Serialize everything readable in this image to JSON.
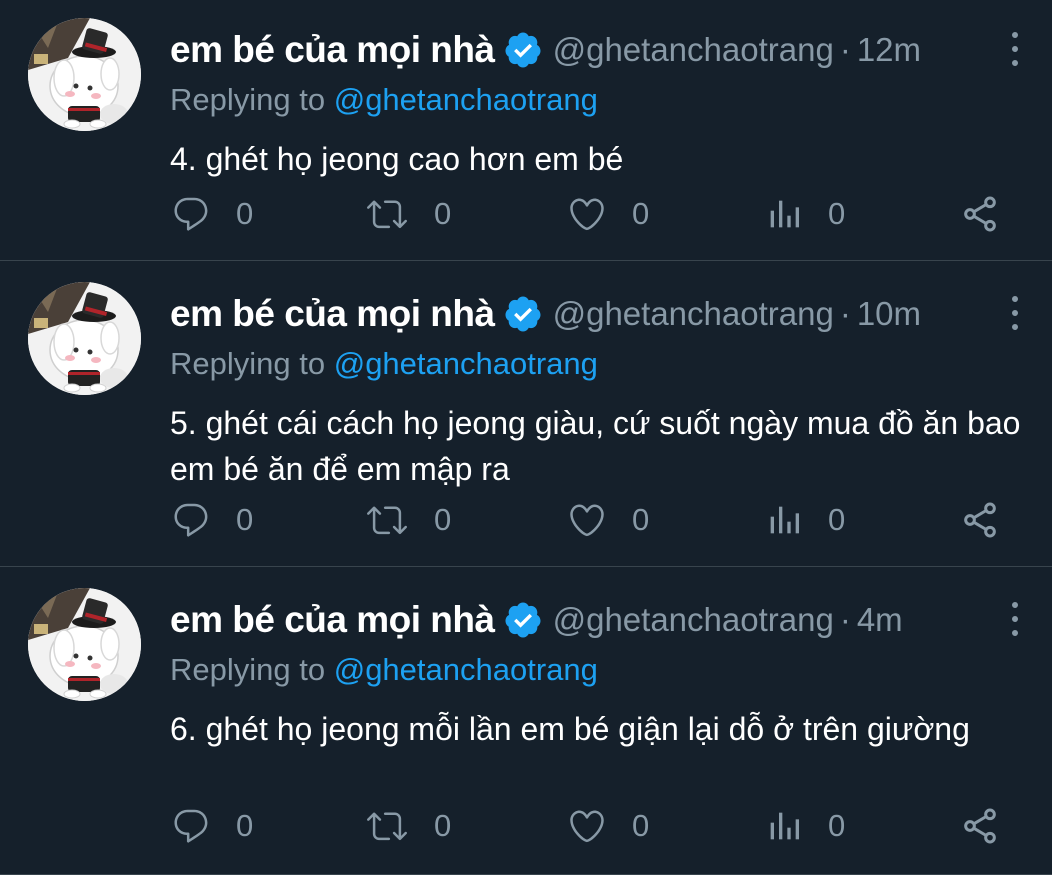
{
  "colors": {
    "background": "#15202b",
    "secondary_text": "#8899a6",
    "mention": "#1da1f2",
    "verified": "#1da1f2",
    "divider": "#38444d"
  },
  "tweets": [
    {
      "display_name": "em bé của mọi nhà",
      "handle": "@ghetanchaotrang",
      "separator": "·",
      "time": "12m",
      "replying_prefix": "Replying to",
      "replying_mention": "@ghetanchaotrang",
      "text": "4. ghét họ jeong cao hơn em bé",
      "reply_count": "0",
      "retweet_count": "0",
      "like_count": "0",
      "views_count": "0"
    },
    {
      "display_name": "em bé của mọi nhà",
      "handle": "@ghetanchaotrang",
      "separator": "·",
      "time": "10m",
      "replying_prefix": "Replying to",
      "replying_mention": "@ghetanchaotrang",
      "text": "5. ghét cái cách họ jeong giàu, cứ suốt ngày mua đồ ăn bao em bé ăn để em mập ra",
      "reply_count": "0",
      "retweet_count": "0",
      "like_count": "0",
      "views_count": "0"
    },
    {
      "display_name": "em bé của mọi nhà",
      "handle": "@ghetanchaotrang",
      "separator": "·",
      "time": "4m",
      "replying_prefix": "Replying to",
      "replying_mention": "@ghetanchaotrang",
      "text": "6. ghét họ jeong mỗi lần em bé giận lại dỗ ở trên giường",
      "reply_count": "0",
      "retweet_count": "0",
      "like_count": "0",
      "views_count": "0"
    }
  ],
  "icons": {
    "avatar": "avatar-image",
    "verified": "verified-badge-icon",
    "more": "more-vertical-icon",
    "reply": "reply-bubble-icon",
    "retweet": "retweet-icon",
    "like": "heart-icon",
    "views": "bar-chart-icon",
    "share": "share-icon"
  }
}
